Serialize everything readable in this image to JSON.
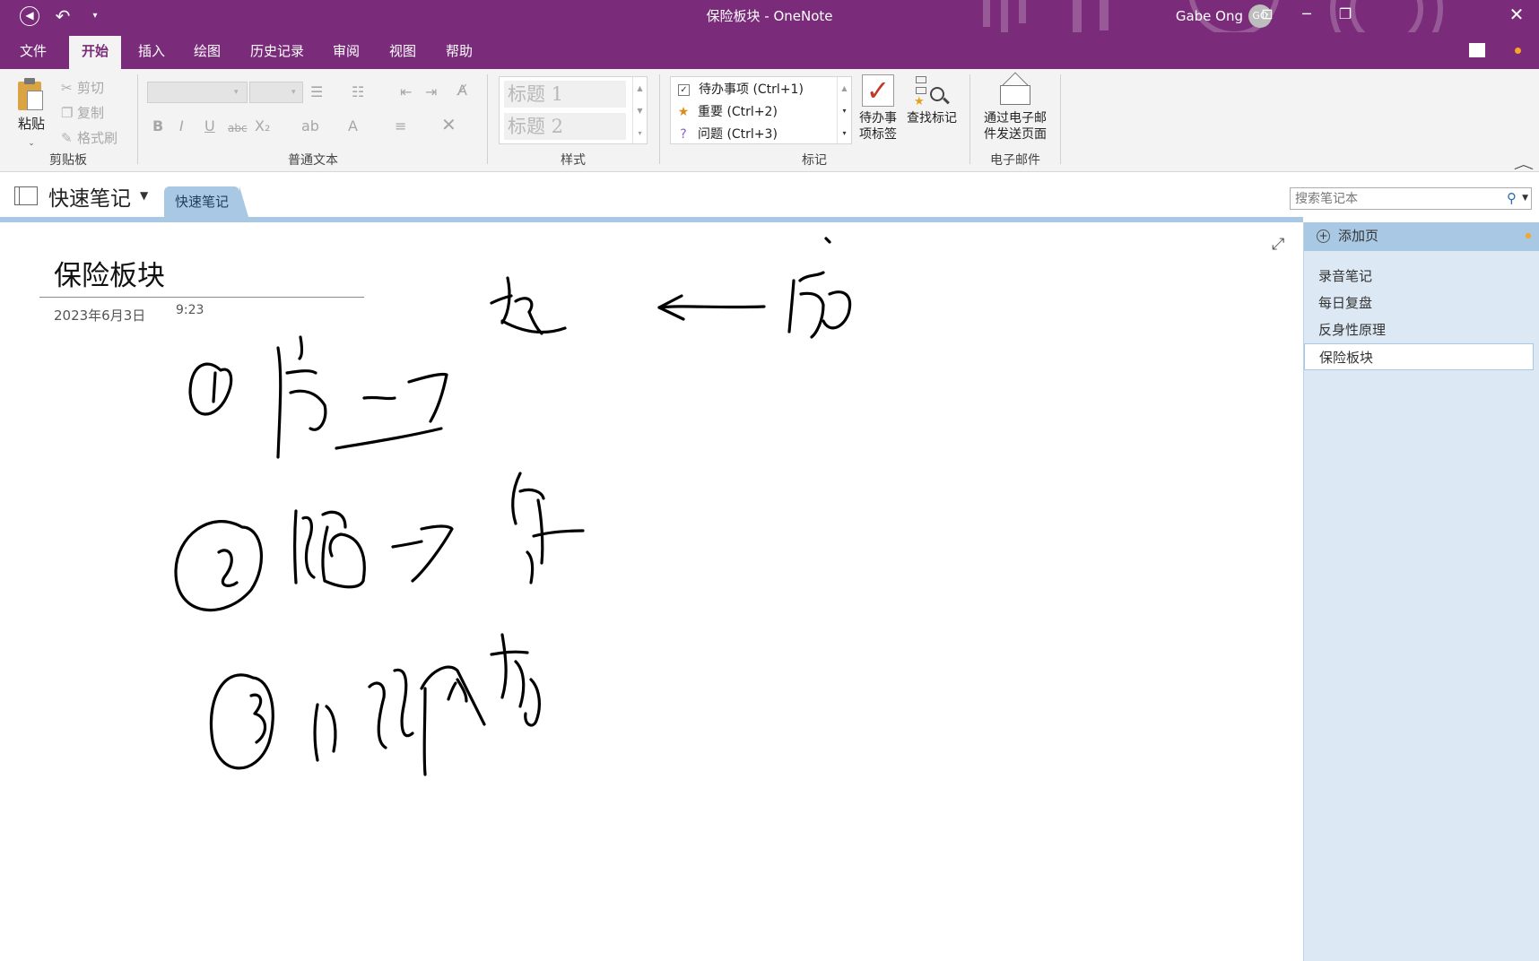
{
  "window": {
    "title": "保险板块 - OneNote",
    "user_name": "Gabe Ong",
    "user_initials": "GO"
  },
  "tabs": [
    "文件",
    "开始",
    "插入",
    "绘图",
    "历史记录",
    "审阅",
    "视图",
    "帮助"
  ],
  "active_tab": "开始",
  "ribbon": {
    "clipboard": {
      "paste": "粘贴",
      "cut": "剪切",
      "copy": "复制",
      "format_painter": "格式刷",
      "label": "剪贴板"
    },
    "basic_text": {
      "label": "普通文本"
    },
    "styles": {
      "heading1": "标题 1",
      "heading2": "标题 2",
      "label": "样式"
    },
    "tags": {
      "items": [
        {
          "text": "待办事项 (Ctrl+1)",
          "icon": "checkbox-icon"
        },
        {
          "text": "重要 (Ctrl+2)",
          "icon": "star-icon"
        },
        {
          "text": "问题 (Ctrl+3)",
          "icon": "question-icon"
        }
      ],
      "todo_tag_line1": "待办事",
      "todo_tag_line2": "项标签",
      "find_tags": "查找标记",
      "label": "标记"
    },
    "email": {
      "line1": "通过电子邮",
      "line2": "件发送页面",
      "label": "电子邮件"
    }
  },
  "notebook": {
    "name": "快速笔记",
    "section_tab": "快速笔记",
    "search_placeholder": "搜索笔记本"
  },
  "page": {
    "title": "保险板块",
    "date": "2023年6月3日",
    "time": "9:23"
  },
  "pages_pane": {
    "add_page": "添加页",
    "pages": [
      "录音笔记",
      "每日复盘",
      "反身性原理",
      "保险板块"
    ],
    "active_page": "保险板块"
  },
  "colors": {
    "title_bar": "#7a2c7a",
    "section_tab": "#a8c8e4",
    "page_pane": "#dce8f3",
    "notification_dot": "#f6a623"
  }
}
